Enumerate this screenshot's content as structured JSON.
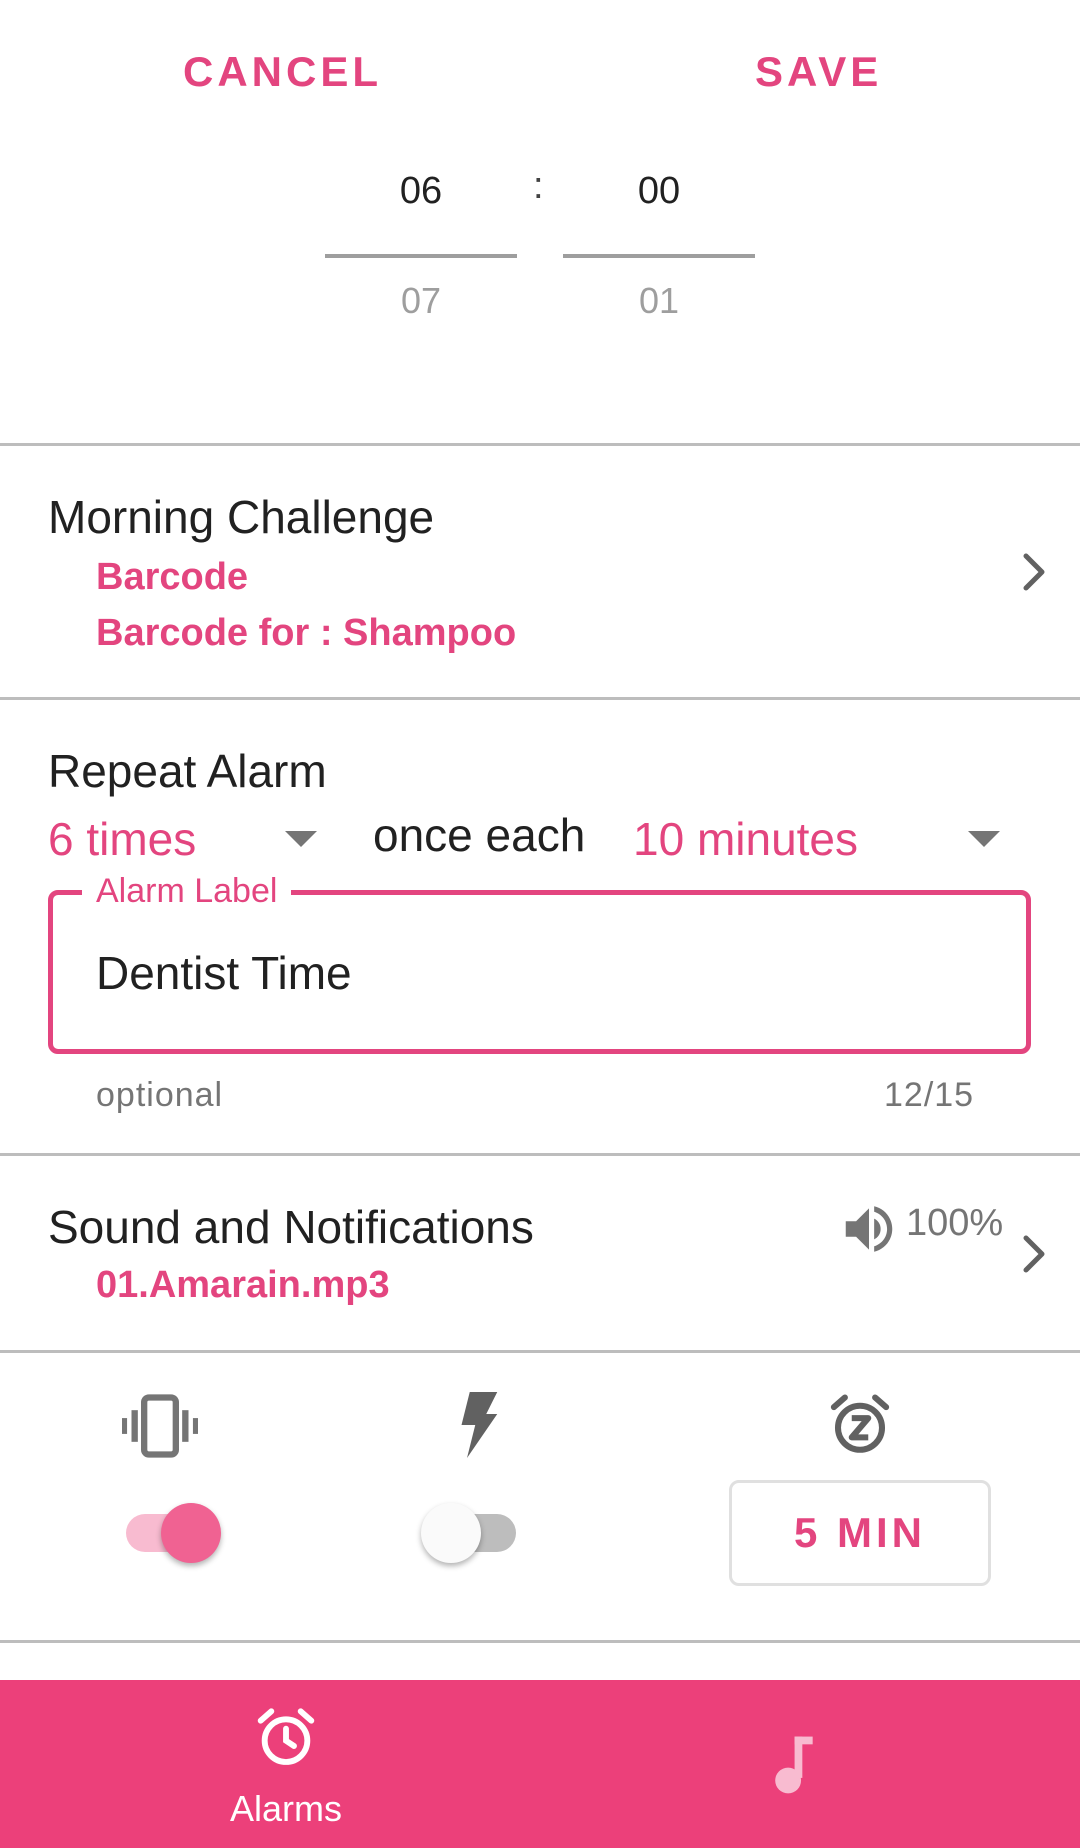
{
  "header": {
    "cancel_label": "CANCEL",
    "save_label": "SAVE"
  },
  "time_picker": {
    "hour_current": "06",
    "hour_next": "07",
    "separator": ":",
    "minute_current": "00",
    "minute_next": "01"
  },
  "challenge": {
    "title": "Morning Challenge",
    "type": "Barcode",
    "detail": "Barcode for : Shampoo"
  },
  "repeat": {
    "title": "Repeat Alarm",
    "times_value": "6 times",
    "connector": "once each",
    "interval_value": "10 minutes"
  },
  "alarm_label": {
    "legend": "Alarm Label",
    "value": "Dentist Time",
    "helper": "optional",
    "counter": "12/15"
  },
  "sound": {
    "title": "Sound and Notifications",
    "file": "01.Amarain.mp3",
    "volume": "100%"
  },
  "options": {
    "vibrate_icon": "vibration-icon",
    "vibrate_on": true,
    "flash_icon": "flash-icon",
    "flash_on": false,
    "snooze_icon": "snooze-icon",
    "snooze_label": "5 MIN"
  },
  "bottom_nav": {
    "alarms_label": "Alarms",
    "alarms_icon": "alarm-clock-icon",
    "music_icon": "music-note-icon"
  },
  "colors": {
    "accent": "#e3457f",
    "nav_background": "#ec407a"
  }
}
